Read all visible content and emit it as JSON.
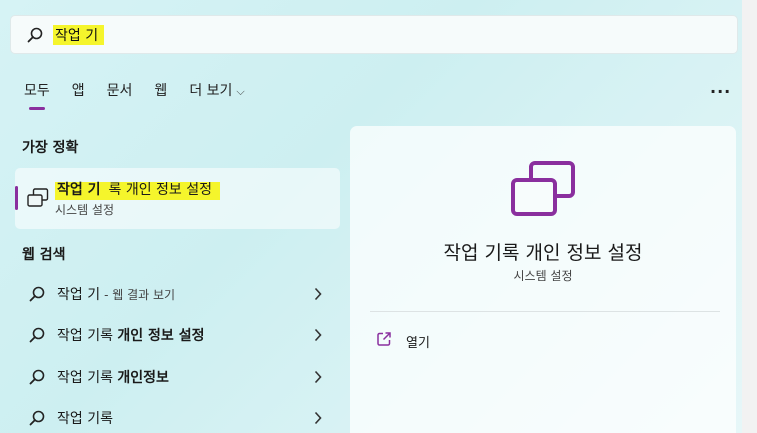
{
  "search": {
    "query": "작업 기"
  },
  "tabs": [
    {
      "label": "모두"
    },
    {
      "label": "앱"
    },
    {
      "label": "문서"
    },
    {
      "label": "웹"
    },
    {
      "label": "더 보기"
    }
  ],
  "more_menu": "...",
  "best_match": {
    "heading": "가장 정확",
    "title_highlight": "작업 기",
    "title_rest": "록 개인 정보 설정",
    "subtitle": "시스템 설정"
  },
  "web_search": {
    "heading": "웹 검색",
    "items": [
      {
        "prefix": "작업 기",
        "bold": "",
        "suffix": "- 웹 결과 보기"
      },
      {
        "prefix": "작업 기록 ",
        "bold": "개인 정보 설정",
        "suffix": ""
      },
      {
        "prefix": "작업 기록 ",
        "bold": "개인정보",
        "suffix": ""
      },
      {
        "prefix": "작업 기록",
        "bold": "",
        "suffix": ""
      }
    ]
  },
  "detail": {
    "title": "작업 기록 개인 정보 설정",
    "subtitle": "시스템 설정",
    "actions": [
      {
        "label": "열기",
        "icon": "open-external-icon"
      }
    ]
  },
  "colors": {
    "accent": "#8a2f9e",
    "highlight": "#f5f52c"
  }
}
